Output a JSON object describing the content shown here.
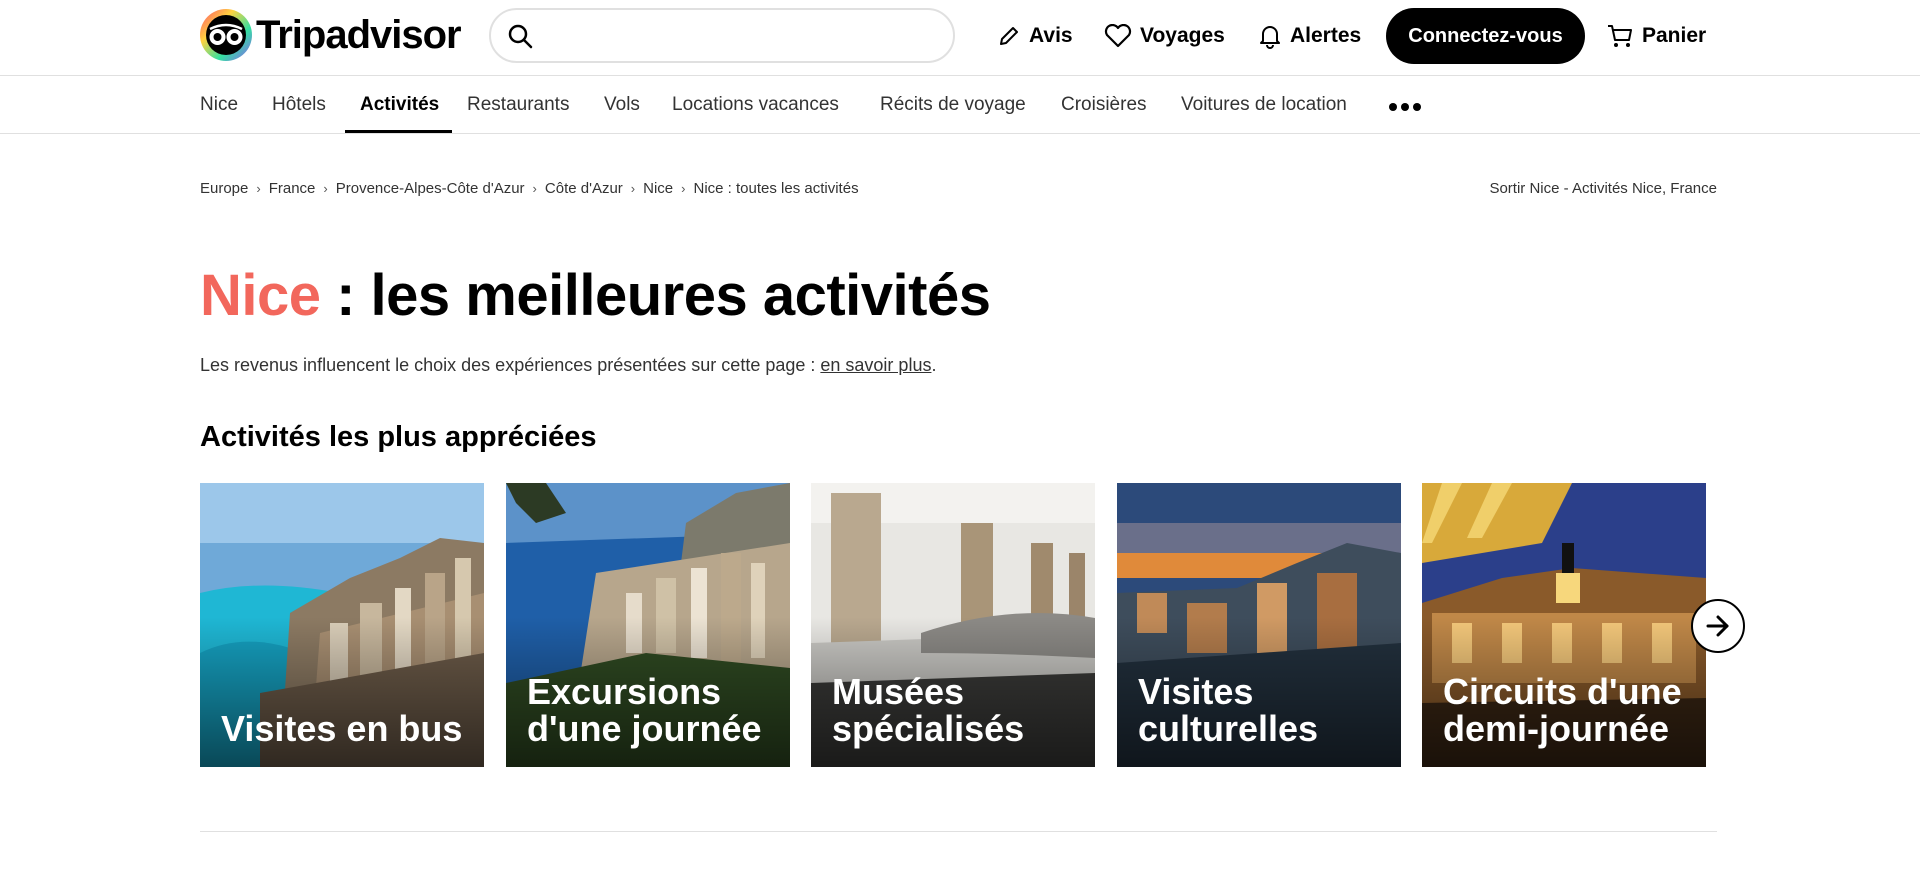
{
  "header": {
    "logo_text": "Tripadvisor",
    "search": {
      "value": "",
      "placeholder": ""
    },
    "nav": {
      "avis": "Avis",
      "voyages": "Voyages",
      "alertes": "Alertes",
      "panier": "Panier"
    },
    "login_label": "Connectez-vous"
  },
  "subnav": {
    "items": [
      "Nice",
      "Hôtels",
      "Activités",
      "Restaurants",
      "Vols",
      "Locations vacances",
      "Récits de voyage",
      "Croisières",
      "Voitures de location"
    ],
    "active": "Activités"
  },
  "breadcrumbs": [
    "Europe",
    "France",
    "Provence-Alpes-Côte d'Azur",
    "Côte d'Azur",
    "Nice",
    "Nice : toutes les activités"
  ],
  "breadcrumb_right": "Sortir Nice - Activités Nice, France",
  "page": {
    "title_city": "Nice",
    "title_rest": " : les meilleures activités",
    "disclaimer_text": "Les revenus influencent le choix des expériences présentées sur cette page : ",
    "disclaimer_link": "en savoir plus",
    "disclaimer_end": "."
  },
  "section": {
    "title": "Activités les plus appréciées",
    "cards": [
      {
        "label": "Visites en bus"
      },
      {
        "label": "Excursions d'une journée"
      },
      {
        "label": "Musées spécialisés"
      },
      {
        "label": "Visites culturelles"
      },
      {
        "label": "Circuits d'une demi-journée"
      }
    ]
  },
  "colors": {
    "brand_accent": "#f2675c",
    "button_bg": "#000000",
    "divider": "#e0e0e0"
  },
  "icons": [
    "tripadvisor-logo-icon",
    "search-icon",
    "pencil-icon",
    "heart-icon",
    "bell-icon",
    "cart-icon",
    "more-icon",
    "chevron-right-icon",
    "arrow-right-icon"
  ]
}
